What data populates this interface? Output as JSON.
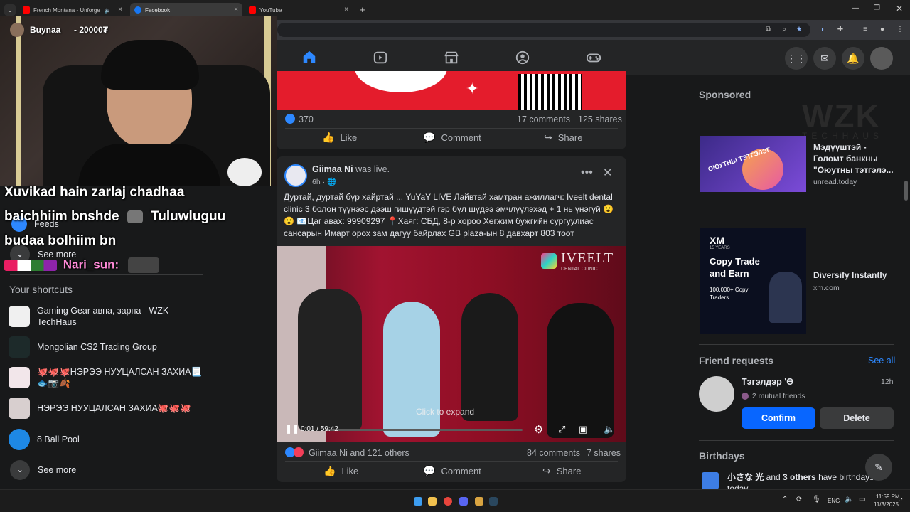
{
  "browser": {
    "tabs": [
      {
        "label": "French Montana - Unforge"
      },
      {
        "label": "Facebook"
      },
      {
        "label": "YouTube"
      }
    ],
    "new_tab": "+"
  },
  "stream": {
    "top_user": "Buynaa",
    "top_amount": "- 20000₮",
    "chat_line1": "Xuvikad hain zarlaj chadhaa",
    "chat_line2": "baichhiim bnshde",
    "chat_line2b": "Tuluwluguu",
    "chat_line3": "budaa bolhiim bn",
    "chat_user": "Nari_sun:"
  },
  "left": {
    "feeds": "Feeds",
    "see_more_top": "See more",
    "shortcuts_title": "Your shortcuts",
    "shortcuts": [
      {
        "label": "Gaming Gear авна, зарна - WZK TechHaus"
      },
      {
        "label": "Mongolian CS2 Trading Group"
      },
      {
        "label": "🐙🐙🐙НЭРЭЭ НУУЦАЛСАН ЗАХИА📃🐟📷🍂"
      },
      {
        "label": "НЭРЭЭ НУУЦАЛСАН ЗАХИА🐙🐙🐙"
      },
      {
        "label": "8 Ball Pool"
      }
    ],
    "see_more_bottom": "See more"
  },
  "post1": {
    "likes": "370",
    "comments": "17 comments",
    "shares": "125 shares",
    "like": "Like",
    "comment": "Comment",
    "share": "Share"
  },
  "post2": {
    "author": "Giimaa Ni",
    "status": "was live.",
    "time": "6h ·",
    "text": "Дуртай, дуртай бүр хайртай ... YuYaY LIVE Лайвтай хамтран ажиллагч: Iveelt dental clinic 3 болон түүнээс дээш гишүүдтэй гэр бүл шүдээ эмчлүүлэхэд + 1 нь үнэгүй 😮 😮 📧Цаг авах: 99909297 📍Хаяг: СБД, 8-р хороо Хөгжим бужгийн сургуулиас сансарын Имарт орох зам дагуу байрлах GB plaza-ын 8 давхарт 803 тоот",
    "video_brand": "IVEELT",
    "video_brand_sub": "DENTAL CLINIC",
    "click_to_expand": "Click to expand",
    "video_time": "0:01 / 59:42",
    "reactions": "Giimaa Ni and 121 others",
    "comments": "84 comments",
    "shares": "7 shares",
    "like": "Like",
    "comment": "Comment",
    "share": "Share"
  },
  "right": {
    "sponsored": "Sponsored",
    "watermark": "WZK",
    "watermark_sub": "TECHHAUS",
    "ads": [
      {
        "title": "Мэдүүштэй - Голомт банкны \"Оюутны тэтгэлэ...",
        "domain": "unread.today",
        "image_text": "ОЮУТНЫ ТЭТГЭЛЭГ"
      },
      {
        "title": "Diversify Instantly",
        "domain": "xm.com",
        "image_logo": "XM",
        "image_sub": "15 YEARS",
        "image_headline": "Copy Trade and Earn",
        "image_stat": "100,000+ Copy Traders"
      }
    ],
    "friend_requests": "Friend requests",
    "see_all": "See all",
    "request": {
      "name": "Тэгэлдэр 'Ө",
      "time": "12h",
      "mutual": "2 mutual friends",
      "confirm": "Confirm",
      "delete": "Delete"
    },
    "birthdays": "Birthdays",
    "birthday_text_a": "小さな 光",
    "birthday_text_b": " and ",
    "birthday_text_c": "3 others",
    "birthday_text_d": " have birthdays today."
  },
  "taskbar": {
    "lang": "ENG",
    "time": "11:59 PM",
    "date": "11/3/2025"
  },
  "colors": {
    "accent": "#2d88ff",
    "fb_bg": "#18191a",
    "card": "#242526",
    "red_banner": "#e41c2c"
  }
}
